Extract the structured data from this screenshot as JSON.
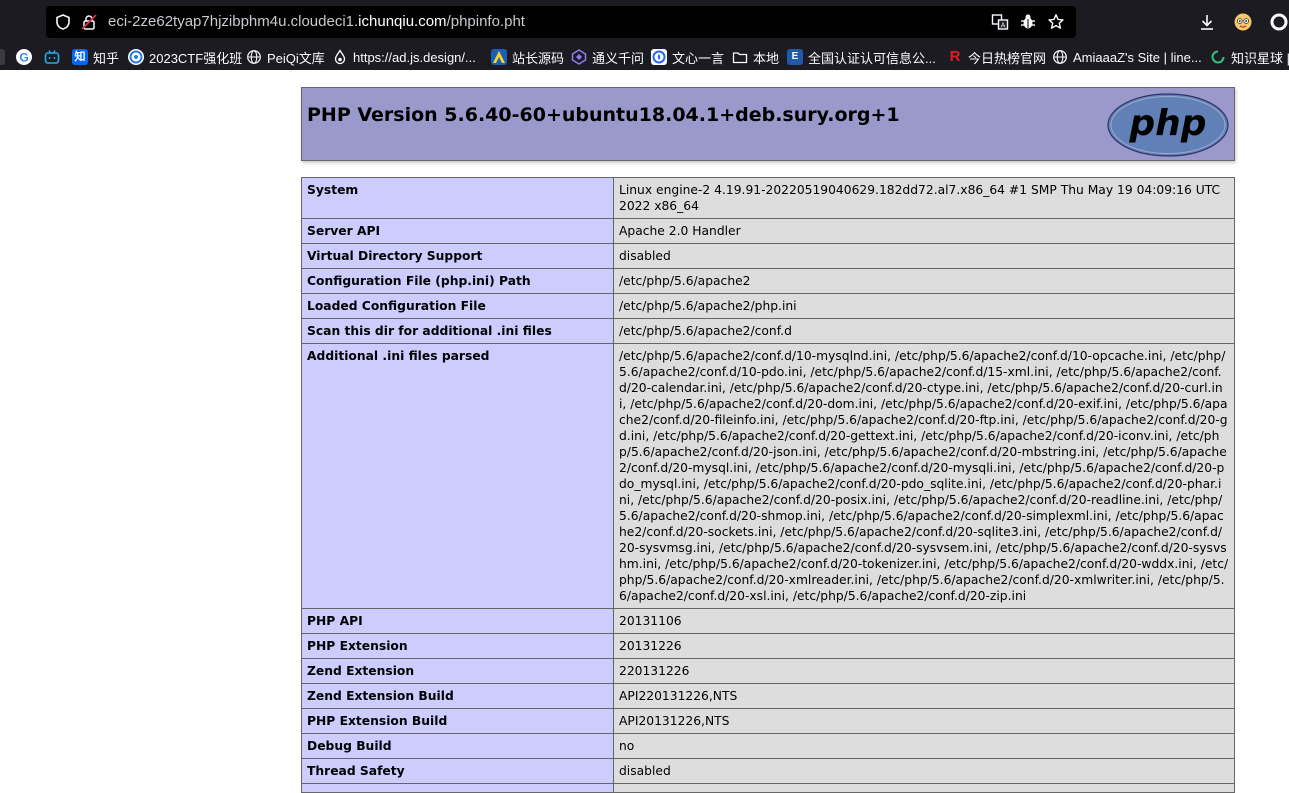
{
  "browser": {
    "url": {
      "prefix": "eci-2ze62tyap7hjzibphm4u.cloudeci1.",
      "domain": "ichunqiu.com",
      "path": "/phpinfo.pht"
    },
    "bookmarks": [
      {
        "label": "",
        "icon": "google-icon"
      },
      {
        "label": "",
        "icon": "bilibili-icon"
      },
      {
        "label": "知乎",
        "icon": "zhihu-icon"
      },
      {
        "label": "2023CTF强化班",
        "icon": "course-icon"
      },
      {
        "label": "PeiQi文库",
        "icon": "globe-icon"
      },
      {
        "label": "https://ad.js.design/...",
        "icon": "jsdesign-icon"
      },
      {
        "label": "站长源码",
        "icon": "site-icon"
      },
      {
        "label": "通义千问",
        "icon": "tongyi-icon"
      },
      {
        "label": "文心一言",
        "icon": "wenxin-icon"
      },
      {
        "label": "本地",
        "icon": "folder-icon"
      },
      {
        "label": "全国认证认可信息公...",
        "icon": "cert-icon"
      },
      {
        "label": "今日热榜官网",
        "icon": "rebang-icon"
      },
      {
        "label": "AmiaaaZ's Site | line...",
        "icon": "globe-icon"
      },
      {
        "label": "知识星球 |",
        "icon": "zsxq-icon"
      }
    ]
  },
  "php": {
    "title": "PHP Version 5.6.40-60+ubuntu18.04.1+deb.sury.org+1",
    "logo_text": "php",
    "rows": [
      {
        "k": "System",
        "v": "Linux engine-2 4.19.91-20220519040629.182dd72.al7.x86_64 #1 SMP Thu May 19 04:09:16 UTC 2022 x86_64"
      },
      {
        "k": "Server API",
        "v": "Apache 2.0 Handler"
      },
      {
        "k": "Virtual Directory Support",
        "v": "disabled"
      },
      {
        "k": "Configuration File (php.ini) Path",
        "v": "/etc/php/5.6/apache2"
      },
      {
        "k": "Loaded Configuration File",
        "v": "/etc/php/5.6/apache2/php.ini"
      },
      {
        "k": "Scan this dir for additional .ini files",
        "v": "/etc/php/5.6/apache2/conf.d"
      },
      {
        "k": "Additional .ini files parsed",
        "v": "/etc/php/5.6/apache2/conf.d/10-mysqlnd.ini, /etc/php/5.6/apache2/conf.d/10-opcache.ini, /etc/php/5.6/apache2/conf.d/10-pdo.ini, /etc/php/5.6/apache2/conf.d/15-xml.ini, /etc/php/5.6/apache2/conf.d/20-calendar.ini, /etc/php/5.6/apache2/conf.d/20-ctype.ini, /etc/php/5.6/apache2/conf.d/20-curl.ini, /etc/php/5.6/apache2/conf.d/20-dom.ini, /etc/php/5.6/apache2/conf.d/20-exif.ini, /etc/php/5.6/apache2/conf.d/20-fileinfo.ini, /etc/php/5.6/apache2/conf.d/20-ftp.ini, /etc/php/5.6/apache2/conf.d/20-gd.ini, /etc/php/5.6/apache2/conf.d/20-gettext.ini, /etc/php/5.6/apache2/conf.d/20-iconv.ini, /etc/php/5.6/apache2/conf.d/20-json.ini, /etc/php/5.6/apache2/conf.d/20-mbstring.ini, /etc/php/5.6/apache2/conf.d/20-mysql.ini, /etc/php/5.6/apache2/conf.d/20-mysqli.ini, /etc/php/5.6/apache2/conf.d/20-pdo_mysql.ini, /etc/php/5.6/apache2/conf.d/20-pdo_sqlite.ini, /etc/php/5.6/apache2/conf.d/20-phar.ini, /etc/php/5.6/apache2/conf.d/20-posix.ini, /etc/php/5.6/apache2/conf.d/20-readline.ini, /etc/php/5.6/apache2/conf.d/20-shmop.ini, /etc/php/5.6/apache2/conf.d/20-simplexml.ini, /etc/php/5.6/apache2/conf.d/20-sockets.ini, /etc/php/5.6/apache2/conf.d/20-sqlite3.ini, /etc/php/5.6/apache2/conf.d/20-sysvmsg.ini, /etc/php/5.6/apache2/conf.d/20-sysvsem.ini, /etc/php/5.6/apache2/conf.d/20-sysvshm.ini, /etc/php/5.6/apache2/conf.d/20-tokenizer.ini, /etc/php/5.6/apache2/conf.d/20-wddx.ini, /etc/php/5.6/apache2/conf.d/20-xmlreader.ini, /etc/php/5.6/apache2/conf.d/20-xmlwriter.ini, /etc/php/5.6/apache2/conf.d/20-xsl.ini, /etc/php/5.6/apache2/conf.d/20-zip.ini"
      },
      {
        "k": "PHP API",
        "v": "20131106"
      },
      {
        "k": "PHP Extension",
        "v": "20131226"
      },
      {
        "k": "Zend Extension",
        "v": "220131226"
      },
      {
        "k": "Zend Extension Build",
        "v": "API220131226,NTS"
      },
      {
        "k": "PHP Extension Build",
        "v": "API20131226,NTS"
      },
      {
        "k": "Debug Build",
        "v": "no"
      },
      {
        "k": "Thread Safety",
        "v": "disabled"
      },
      {
        "k": "",
        "v": ""
      }
    ]
  },
  "colors": {
    "header_bg": "#9999cc",
    "key_bg": "#ccccff",
    "value_bg": "#dddddd",
    "chrome_bg": "#1c1b22"
  }
}
